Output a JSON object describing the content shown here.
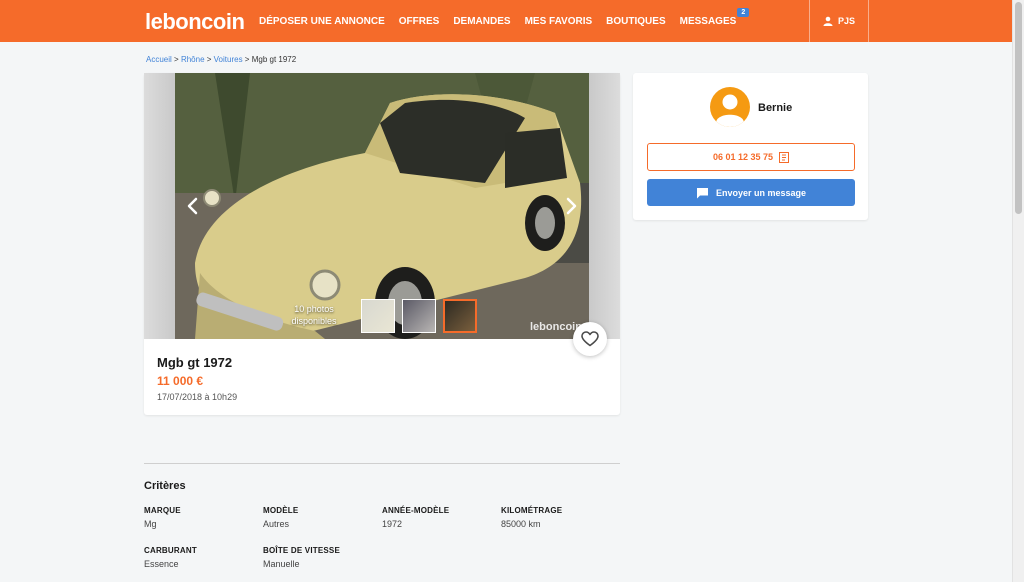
{
  "header": {
    "logo": "leboncoin",
    "nav": [
      {
        "label": "DÉPOSER UNE ANNONCE"
      },
      {
        "label": "OFFRES"
      },
      {
        "label": "DEMANDES"
      },
      {
        "label": "MES FAVORIS"
      },
      {
        "label": "BOUTIQUES"
      },
      {
        "label": "MESSAGES",
        "badge": "2"
      }
    ],
    "user_label": "PJS"
  },
  "breadcrumb": {
    "items": [
      "Accueil",
      "Rhône",
      "Voitures"
    ],
    "current": "Mgb gt 1972",
    "separator": ">"
  },
  "ad": {
    "photo_count": "10 photos disponibles",
    "watermark": "leboncoin",
    "title": "Mgb gt 1972",
    "price": "11 000 €",
    "date": "17/07/2018 à 10h29"
  },
  "seller": {
    "name": "Bernie",
    "phone": "06 01 12 35 75",
    "message_button": "Envoyer un message"
  },
  "criteria": {
    "title": "Critères",
    "items": [
      {
        "label": "Marque",
        "value": "Mg"
      },
      {
        "label": "Modèle",
        "value": "Autres"
      },
      {
        "label": "Année-modèle",
        "value": "1972"
      },
      {
        "label": "Kilométrage",
        "value": "85000 km"
      },
      {
        "label": "Carburant",
        "value": "Essence"
      },
      {
        "label": "Boîte de vitesse",
        "value": "Manuelle"
      }
    ]
  },
  "colors": {
    "brand": "#f56b2a",
    "link": "#4183d7",
    "background": "#f4f6f7"
  },
  "icons": [
    "user-icon",
    "chevron-left-icon",
    "chevron-right-icon",
    "heart-icon",
    "avatar-icon",
    "phone-icon",
    "chat-icon"
  ]
}
